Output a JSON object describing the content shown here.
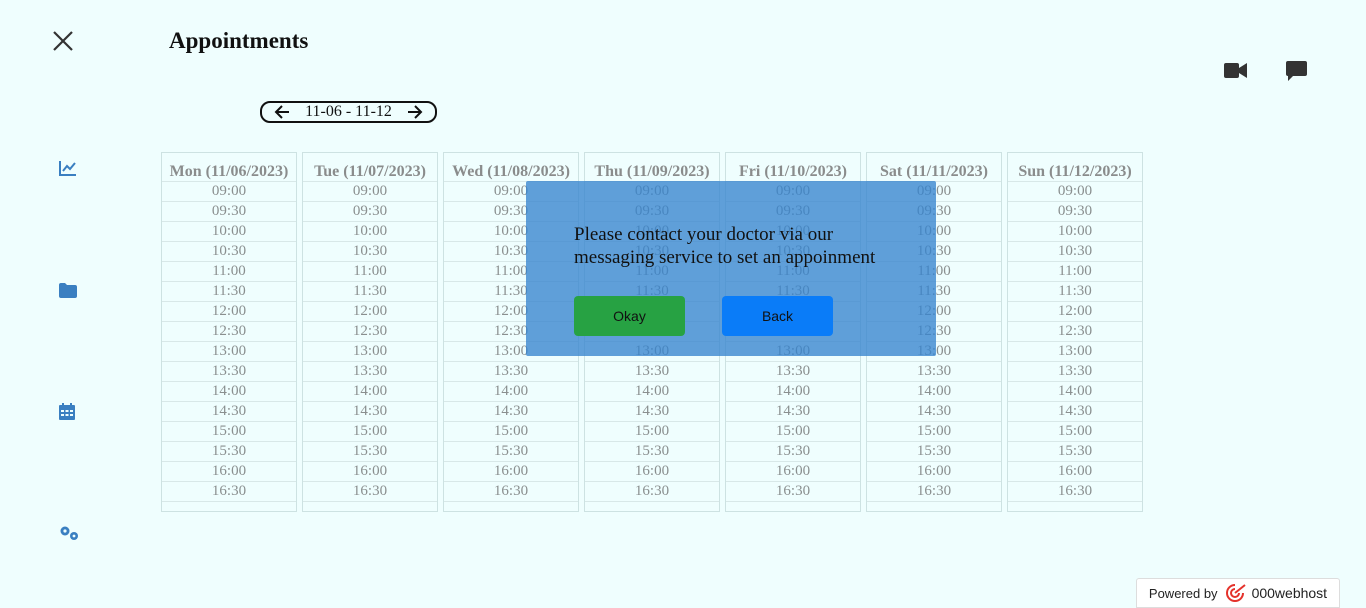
{
  "header": {
    "title": "Appointments"
  },
  "week_nav": {
    "range": "11-06 - 11-12"
  },
  "days": [
    "Mon (11/06/2023)",
    "Tue (11/07/2023)",
    "Wed (11/08/2023)",
    "Thu (11/09/2023)",
    "Fri (11/10/2023)",
    "Sat (11/11/2023)",
    "Sun (11/12/2023)"
  ],
  "slots": [
    "09:00",
    "09:30",
    "10:00",
    "10:30",
    "11:00",
    "11:30",
    "12:00",
    "12:30",
    "13:00",
    "13:30",
    "14:00",
    "14:30",
    "15:00",
    "15:30",
    "16:00",
    "16:30"
  ],
  "modal": {
    "message": "Please contact your doctor via our messaging service to set an appoinment",
    "okay_label": "Okay",
    "back_label": "Back"
  },
  "footer": {
    "powered_by": "Powered by",
    "brand": "000webhost"
  },
  "icons": {
    "close": "close-icon",
    "video": "video-camera-icon",
    "message": "chat-bubble-icon",
    "sidebar": [
      "line-chart-icon",
      "folder-icon",
      "calendar-icon",
      "gears-icon"
    ]
  },
  "colors": {
    "background": "#effefe",
    "sidebar_icon": "#3a7fc1",
    "modal_bg": "#3684ce",
    "okay": "#27a243",
    "back": "#0a7cf8"
  }
}
